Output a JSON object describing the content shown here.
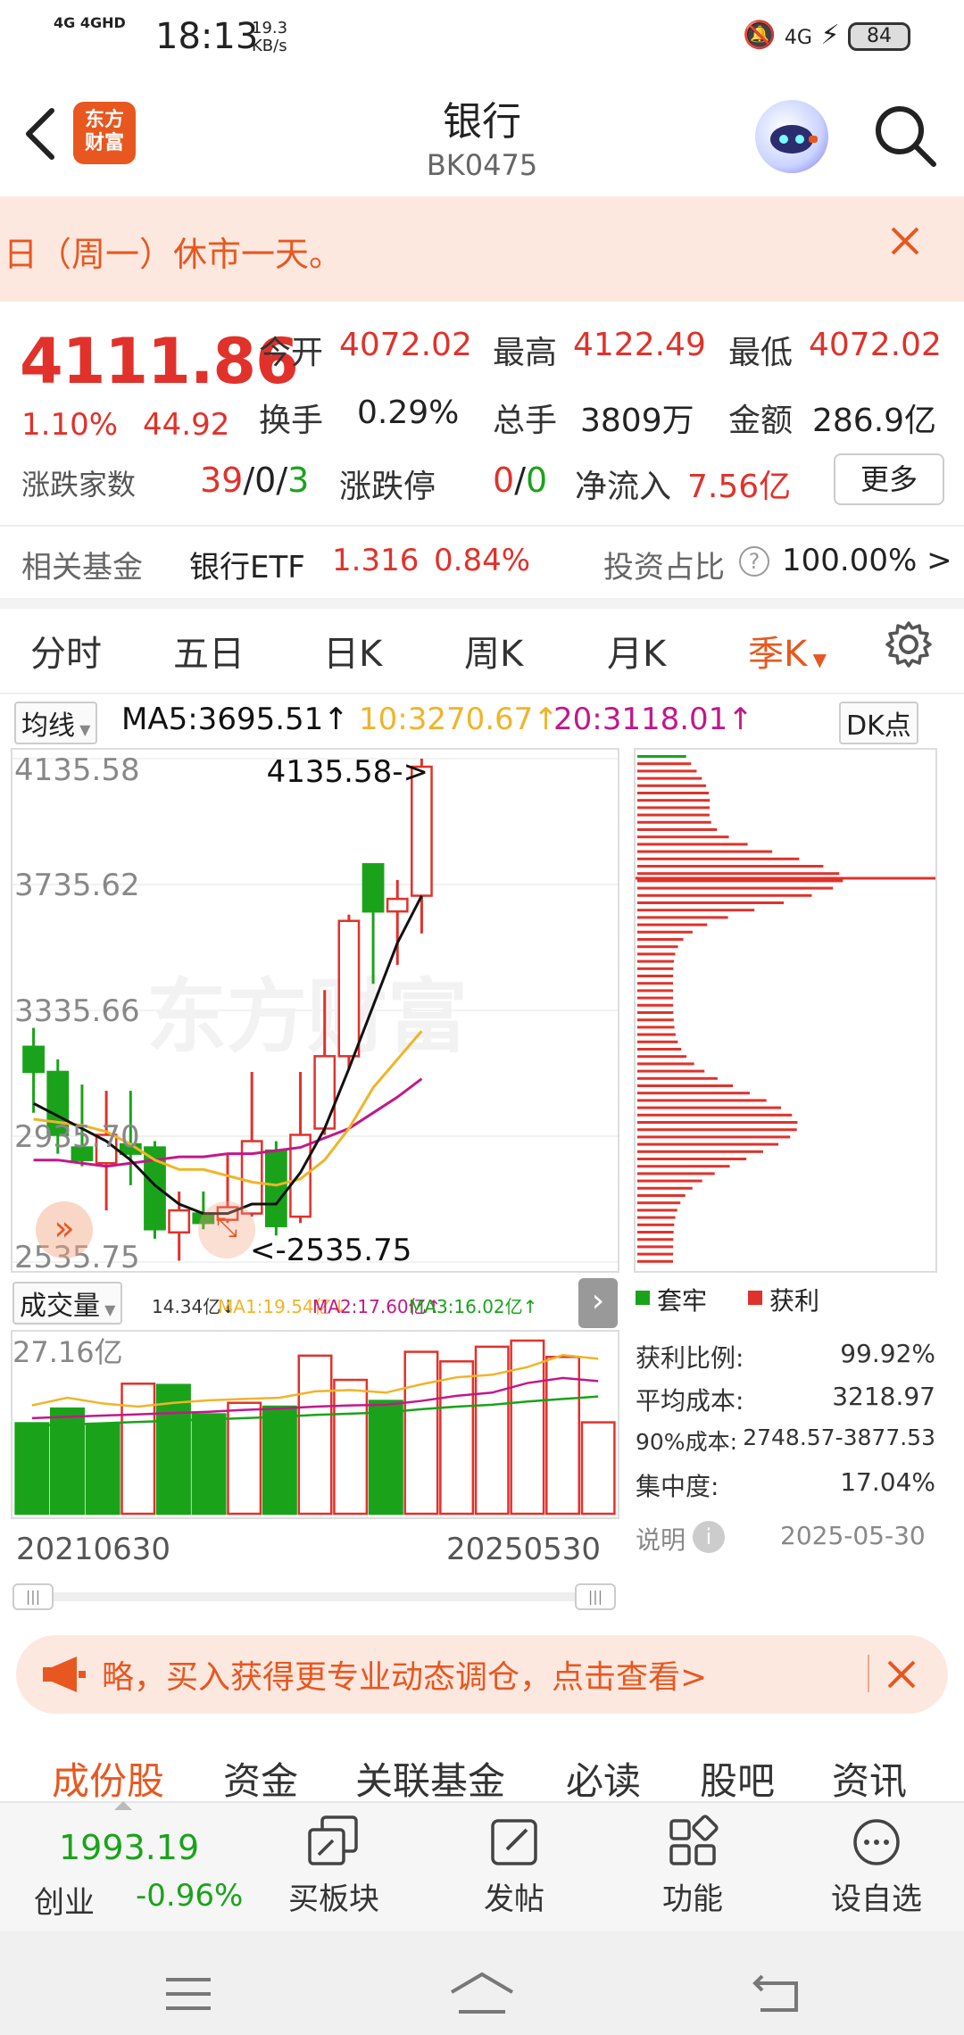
{
  "status_bar": {
    "network": "4G 4GHD",
    "time": "18:13",
    "speed_value": "19.3",
    "speed_unit": "KB/s",
    "net_right": "4G",
    "battery": "84"
  },
  "header": {
    "logo_text": "东方\n财富",
    "title": "银行",
    "code": "BK0475"
  },
  "notice": {
    "text": "日（周一）休市一天。"
  },
  "quote": {
    "price": "4111.86",
    "change_pct": "1.10%",
    "change_val": "44.92",
    "open_label": "今开",
    "open": "4072.02",
    "high_label": "最高",
    "high": "4122.49",
    "low_label": "最低",
    "low": "4072.02",
    "turnover_label": "换手",
    "turnover": "0.29%",
    "volume_label": "总手",
    "volume": "3809万",
    "amount_label": "金额",
    "amount": "286.9亿",
    "updown_label": "涨跌家数",
    "up": "39",
    "flat": "0",
    "down": "3",
    "limit_label": "涨跌停",
    "limit_up": "0",
    "limit_down": "0",
    "netflow_label": "净流入",
    "netflow": "7.56亿",
    "more": "更多",
    "slash": "/"
  },
  "fund": {
    "label": "相关基金",
    "name": "银行ETF",
    "price": "1.316",
    "pct": "0.84%",
    "invest_label": "投资占比",
    "invest_value": "100.00% >"
  },
  "kline_tabs": [
    {
      "label": "分时"
    },
    {
      "label": "五日"
    },
    {
      "label": "日K"
    },
    {
      "label": "周K"
    },
    {
      "label": "月K"
    },
    {
      "label": "季K"
    }
  ],
  "ma": {
    "selector": "均线",
    "ma5": "MA5:3695.51↑",
    "ma10": "10:3270.67↑",
    "ma20": "20:3118.01↑",
    "dk": "DK点"
  },
  "chart": {
    "y_labels": [
      "4135.58",
      "3735.62",
      "3335.66",
      "2935.70",
      "2535.75"
    ],
    "max_note": "4135.58->",
    "min_note": "<-2535.75",
    "watermark": "东方财富"
  },
  "volume": {
    "selector": "成交量",
    "v": "14.34亿↓",
    "ma1": "MA1:19.54亿↓",
    "ma2": "MA2:17.60亿↑",
    "ma3": "MA3:16.02亿↑",
    "max_label": "27.16亿",
    "start_date": "20210630",
    "end_date": "20250530"
  },
  "chip": {
    "legend_trapped": "套牢",
    "legend_profit": "获利",
    "stats": [
      {
        "label": "获利比例:",
        "value": "99.92%"
      },
      {
        "label": "平均成本:",
        "value": "3218.97"
      },
      {
        "label": "90%成本:",
        "value": "2748.57-3877.53"
      },
      {
        "label": "集中度:",
        "value": "17.04%"
      }
    ],
    "note_label": "说明",
    "date": "2025-05-30"
  },
  "ad": {
    "text": "略，买入获得更专业动态调仓，点击查看>"
  },
  "bottom_tabs": [
    {
      "label": "成份股"
    },
    {
      "label": "资金"
    },
    {
      "label": "关联基金"
    },
    {
      "label": "必读"
    },
    {
      "label": "股吧"
    },
    {
      "label": "资讯"
    }
  ],
  "bottom_bar": {
    "index_value": "1993.19",
    "index_name": "创业",
    "index_pct": "-0.96%",
    "buy_block": "买板块",
    "post": "发帖",
    "functions": "功能",
    "add_watch": "设自选"
  },
  "colors": {
    "up": "#e0322b",
    "down": "#1aa31a",
    "accent": "#e8571f",
    "ma5": "#111111",
    "ma10": "#f0b429",
    "ma20": "#c2188a"
  },
  "chart_data": {
    "type": "candlestick",
    "candles": [
      {
        "o": 3220,
        "c": 3140,
        "h": 3280,
        "l": 3010
      },
      {
        "o": 3140,
        "c": 2940,
        "h": 3180,
        "l": 2880
      },
      {
        "o": 2900,
        "c": 2860,
        "h": 3100,
        "l": 2840
      },
      {
        "o": 2850,
        "c": 2940,
        "h": 3080,
        "l": 2700
      },
      {
        "o": 2910,
        "c": 2880,
        "h": 3080,
        "l": 2780
      },
      {
        "o": 2900,
        "c": 2640,
        "h": 2920,
        "l": 2610
      },
      {
        "o": 2630,
        "c": 2700,
        "h": 2760,
        "l": 2540
      },
      {
        "o": 2690,
        "c": 2660,
        "h": 2760,
        "l": 2640
      },
      {
        "o": 2670,
        "c": 2710,
        "h": 2880,
        "l": 2660
      },
      {
        "o": 2690,
        "c": 2920,
        "h": 3140,
        "l": 2680
      },
      {
        "o": 2890,
        "c": 2650,
        "h": 2920,
        "l": 2620
      },
      {
        "o": 2680,
        "c": 2940,
        "h": 3140,
        "l": 2660
      },
      {
        "o": 2960,
        "c": 3190,
        "h": 3400,
        "l": 2940
      },
      {
        "o": 3190,
        "c": 3620,
        "h": 3640,
        "l": 3150
      },
      {
        "o": 3800,
        "c": 3650,
        "h": 3800,
        "l": 3420
      },
      {
        "o": 3650,
        "c": 3690,
        "h": 3750,
        "l": 3480
      },
      {
        "o": 3700,
        "c": 4110,
        "h": 4135.58,
        "l": 3580
      }
    ],
    "ma5": [
      3040,
      3000,
      2960,
      2920,
      2860,
      2780,
      2720,
      2690,
      2690,
      2720,
      2720,
      2820,
      2960,
      3150,
      3350,
      3550,
      3700
    ],
    "ma10": [
      2990,
      2980,
      2970,
      2950,
      2910,
      2860,
      2830,
      2830,
      2810,
      2790,
      2780,
      2800,
      2860,
      2960,
      3090,
      3180,
      3270
    ],
    "ma20": [
      2860,
      2860,
      2850,
      2840,
      2850,
      2860,
      2870,
      2870,
      2880,
      2880,
      2890,
      2900,
      2930,
      2960,
      3010,
      3060,
      3118
    ],
    "volumes": [
      14.2,
      16.5,
      14.0,
      20.4,
      20.2,
      15.6,
      17.4,
      16.8,
      24.8,
      21.0,
      17.7,
      25.4,
      23.9,
      26.2,
      27.16,
      24.6,
      14.34
    ],
    "volume_up": [
      false,
      false,
      false,
      true,
      false,
      false,
      true,
      false,
      true,
      true,
      false,
      true,
      true,
      true,
      true,
      true,
      true
    ],
    "vol_ma1": [
      17.0,
      18.2,
      17.3,
      16.8,
      17.4,
      17.8,
      18.0,
      18.2,
      19.2,
      19.4,
      19.0,
      20.3,
      21.4,
      21.8,
      23.0,
      24.9,
      24.3
    ],
    "vol_ma2": [
      15.0,
      15.2,
      15.4,
      15.6,
      15.8,
      16.0,
      16.3,
      16.5,
      16.8,
      17.0,
      17.1,
      17.7,
      18.5,
      19.0,
      20.5,
      21.3,
      20.8
    ],
    "vol_ma3": [
      13.8,
      14.0,
      14.2,
      14.4,
      14.6,
      14.8,
      15.0,
      15.2,
      15.5,
      15.7,
      15.9,
      16.4,
      16.8,
      17.1,
      17.6,
      18.0,
      18.4
    ],
    "y_range": [
      2535.75,
      4135.58
    ],
    "vol_max": 27.16
  }
}
